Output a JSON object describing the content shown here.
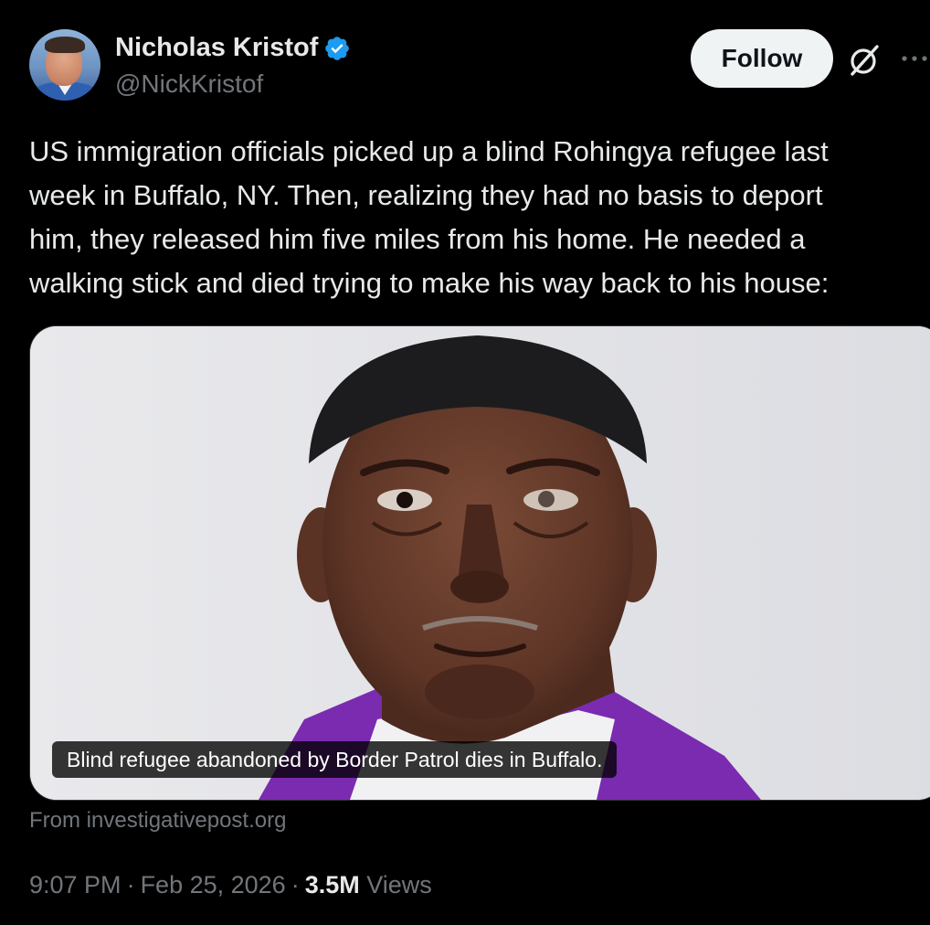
{
  "author": {
    "display_name": "Nicholas Kristof",
    "handle": "@NickKristof",
    "verified": true
  },
  "actions": {
    "follow_label": "Follow"
  },
  "tweet": {
    "text": "US immigration officials picked up a blind Rohingya refugee last\nweek in Buffalo, NY. Then, realizing they had no basis to deport\nhim, they released him five miles from his home. He needed a\nwalking stick and died trying to make his way back to his house:"
  },
  "card": {
    "caption": "Blind refugee abandoned by Border Patrol dies in Buffalo.",
    "source": "From investigativepost.org"
  },
  "meta": {
    "time": "9:07 PM",
    "date": "Feb 25, 2026",
    "separator": "·",
    "views_count": "3.5M",
    "views_label": "Views"
  },
  "colors": {
    "background": "#000000",
    "text_primary": "#e7e9ea",
    "text_secondary": "#71767b",
    "verified_blue": "#1d9bf0",
    "follow_button_bg": "#eff3f4"
  },
  "icons": {
    "verified": "verified-badge-icon",
    "grok": "grok-icon",
    "more": "more-options-icon"
  }
}
